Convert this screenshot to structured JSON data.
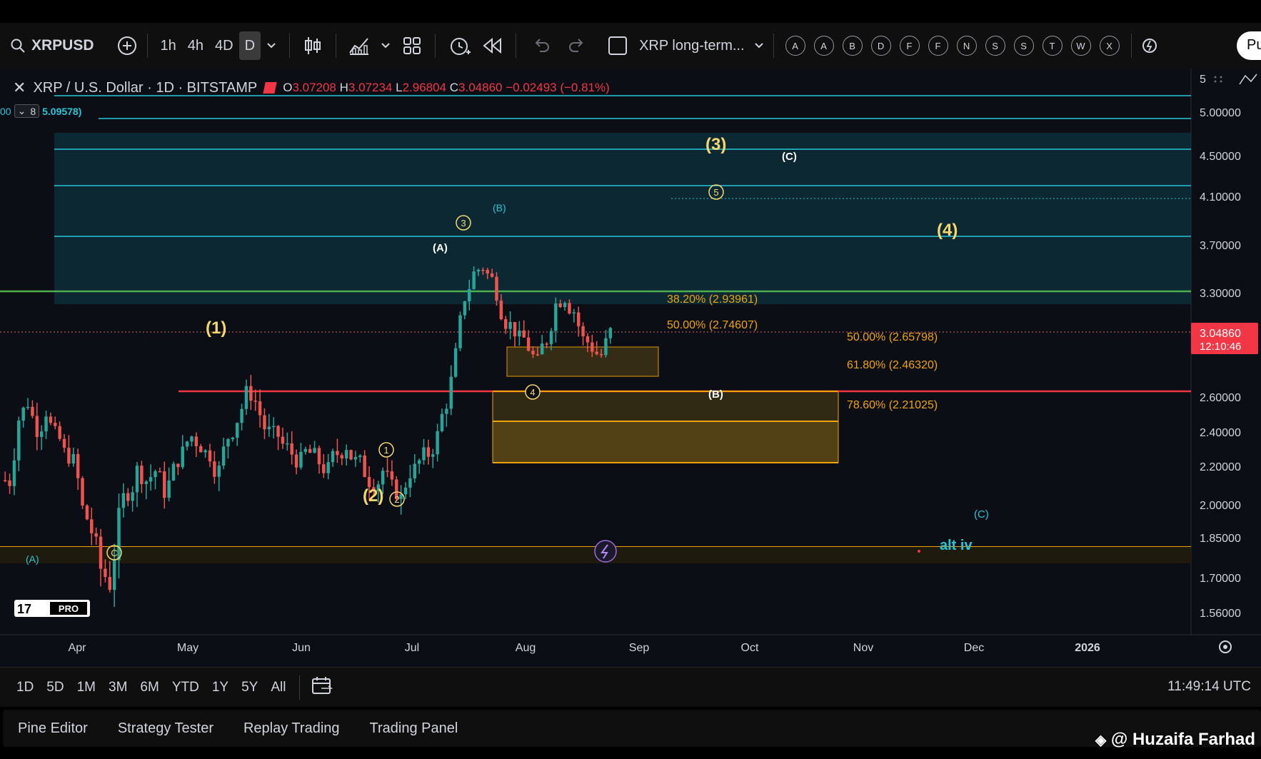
{
  "toolbar": {
    "symbol": "XRPUSD",
    "timeframes": [
      "1h",
      "4h",
      "4D",
      "D"
    ],
    "active_timeframe": "D",
    "layout_name": "XRP long-term...",
    "circle_buttons": [
      "A",
      "A",
      "B",
      "D",
      "F",
      "F",
      "N",
      "S",
      "S",
      "T",
      "W",
      "X"
    ],
    "publish_label": "Pu"
  },
  "legend": {
    "title": "XRP / U.S. Dollar · 1D · BITSTAMP",
    "o_label": "O",
    "o": "3.07208",
    "h_label": "H",
    "h": "3.07234",
    "l_label": "L",
    "l": "2.96804",
    "c_label": "C",
    "c": "3.04860",
    "change": "−0.02493 (−0.81%)",
    "collapse_count": "8",
    "left_level": "5.09578)",
    "left_prefix": "00"
  },
  "colors": {
    "up": "#26a69a",
    "down": "#ef5350",
    "fib_blue": "#26c6da",
    "green_line": "#4caf50",
    "red_line": "#f23645",
    "orange": "#f0a30a",
    "wave_yellow": "#f5d76e"
  },
  "price_axis": {
    "ticks": [
      "5.00000",
      "4.50000",
      "4.10000",
      "3.70000",
      "3.30000",
      "2.60000",
      "2.40000",
      "2.20000",
      "2.00000",
      "1.85000",
      "1.70000",
      "1.56000"
    ],
    "top_partial": "5",
    "current_price": "3.04860",
    "countdown": "12:10:46"
  },
  "time_axis": {
    "labels": [
      "Apr",
      "May",
      "Jun",
      "Jul",
      "Aug",
      "Sep",
      "Oct",
      "Nov",
      "Dec",
      "2026"
    ]
  },
  "fib_labels": {
    "f382": "38.20% (2.93961)",
    "f500a": "50.00% (2.74607)",
    "f500b": "50.00% (2.65798)",
    "f618": "61.80% (2.46320)",
    "f786": "78.60% (2.21025)"
  },
  "wave_labels": {
    "w1": "(1)",
    "w2": "(2)",
    "w3": "(3)",
    "w4": "(4)",
    "A": "(A)",
    "B": "(B)",
    "C": "(C)",
    "B_box": "(B)",
    "B_teal": "(B)",
    "C_teal": "(C)",
    "A_bottom": "(A)",
    "sub1": "1",
    "sub2": "2",
    "sub3": "3",
    "sub4": "4",
    "sub5": "5",
    "subC": "C",
    "alt": "alt iv"
  },
  "bottom": {
    "ranges": [
      "1D",
      "5D",
      "1M",
      "3M",
      "6M",
      "YTD",
      "1Y",
      "5Y",
      "All"
    ],
    "clock": "11:49:14 UTC"
  },
  "panels": [
    "Pine Editor",
    "Strategy Tester",
    "Replay Trading",
    "Trading Panel"
  ],
  "logo": {
    "badge": "PRO"
  },
  "watermark": "@ Huzaifa Farhad",
  "chart_data": {
    "type": "candlestick",
    "title": "XRP / U.S. Dollar · 1D · BITSTAMP",
    "ylim": [
      1.5,
      5.1
    ],
    "x": [
      "Apr",
      "May",
      "Jun",
      "Jul",
      "Aug",
      "Sep",
      "Oct",
      "Nov",
      "Dec",
      "2026"
    ],
    "close_series": [
      2.15,
      2.5,
      2.6,
      2.45,
      2.55,
      2.4,
      2.3,
      2.25,
      2.0,
      1.9,
      1.75,
      1.7,
      1.95,
      2.1,
      2.2,
      2.15,
      2.2,
      2.1,
      2.2,
      2.3,
      2.4,
      2.35,
      2.3,
      2.2,
      2.4,
      2.5,
      2.65,
      2.6,
      2.45,
      2.4,
      2.35,
      2.3,
      2.25,
      2.3,
      2.25,
      2.2,
      2.3,
      2.35,
      2.25,
      2.2,
      2.15,
      2.2,
      2.1,
      2.05,
      2.2,
      2.25,
      2.3,
      2.4,
      2.6,
      2.9,
      3.3,
      3.5,
      3.55,
      3.45,
      3.2,
      3.1,
      3.0,
      2.95,
      2.85,
      3.0,
      3.25,
      3.3,
      3.2,
      3.0,
      2.95,
      2.9,
      3.05
    ],
    "levels": [
      {
        "name": "38.20%",
        "value": 2.93961
      },
      {
        "name": "50.00%",
        "value": 2.74607
      },
      {
        "name": "50.00%",
        "value": 2.65798
      },
      {
        "name": "61.80%",
        "value": 2.4632
      },
      {
        "name": "78.60%",
        "value": 2.21025
      }
    ]
  }
}
